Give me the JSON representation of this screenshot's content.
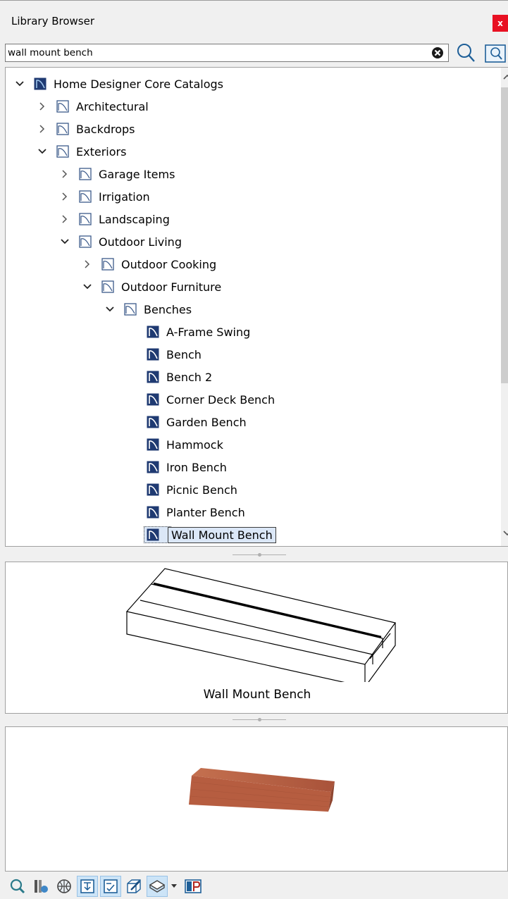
{
  "window": {
    "title": "Library Browser",
    "close_label": "x"
  },
  "search": {
    "value": "wall mount bench"
  },
  "tree": {
    "rows": [
      {
        "label": "Home Designer Core Catalogs",
        "level": 0,
        "state": "expanded",
        "icon": "catalog-root-icon"
      },
      {
        "label": "Architectural",
        "level": 1,
        "state": "collapsed",
        "icon": "folder-icon"
      },
      {
        "label": "Backdrops",
        "level": 1,
        "state": "collapsed",
        "icon": "folder-icon"
      },
      {
        "label": "Exteriors",
        "level": 1,
        "state": "expanded",
        "icon": "folder-icon"
      },
      {
        "label": "Garage Items",
        "level": 2,
        "state": "collapsed",
        "icon": "folder-icon"
      },
      {
        "label": "Irrigation",
        "level": 2,
        "state": "collapsed",
        "icon": "folder-icon"
      },
      {
        "label": "Landscaping",
        "level": 2,
        "state": "collapsed",
        "icon": "folder-icon"
      },
      {
        "label": "Outdoor Living",
        "level": 2,
        "state": "expanded",
        "icon": "folder-icon"
      },
      {
        "label": "Outdoor Cooking",
        "level": 3,
        "state": "collapsed",
        "icon": "folder-icon"
      },
      {
        "label": "Outdoor Furniture",
        "level": 3,
        "state": "expanded",
        "icon": "folder-icon"
      },
      {
        "label": "Benches",
        "level": 4,
        "state": "expanded",
        "icon": "folder-icon"
      },
      {
        "label": "A-Frame Swing",
        "level": 5,
        "state": "leaf",
        "icon": "library-item-icon"
      },
      {
        "label": "Bench",
        "level": 5,
        "state": "leaf",
        "icon": "library-item-icon"
      },
      {
        "label": "Bench 2",
        "level": 5,
        "state": "leaf",
        "icon": "library-item-icon"
      },
      {
        "label": "Corner Deck Bench",
        "level": 5,
        "state": "leaf",
        "icon": "library-item-icon"
      },
      {
        "label": "Garden Bench",
        "level": 5,
        "state": "leaf",
        "icon": "library-item-icon"
      },
      {
        "label": "Hammock",
        "level": 5,
        "state": "leaf",
        "icon": "library-item-icon"
      },
      {
        "label": "Iron Bench",
        "level": 5,
        "state": "leaf",
        "icon": "library-item-icon"
      },
      {
        "label": "Picnic Bench",
        "level": 5,
        "state": "leaf",
        "icon": "library-item-icon"
      },
      {
        "label": "Planter Bench",
        "level": 5,
        "state": "leaf",
        "icon": "library-item-icon"
      },
      {
        "label": "Wall Mount Bench",
        "level": 5,
        "state": "leaf",
        "icon": "library-item-icon",
        "selected": true
      }
    ]
  },
  "preview": {
    "label": "Wall Mount Bench"
  },
  "toolbar": {
    "buttons": [
      {
        "icon": "find-icon",
        "active": false
      },
      {
        "icon": "object-library-icon",
        "active": false
      },
      {
        "icon": "globe-library-icon",
        "active": false
      },
      {
        "icon": "tree-view-icon",
        "active": true
      },
      {
        "icon": "list-view-icon",
        "active": true
      },
      {
        "icon": "3d-view-icon",
        "active": false
      },
      {
        "icon": "preview-render-icon",
        "active": true,
        "has_dropdown": true
      },
      {
        "icon": "ep-icon",
        "active": false
      }
    ]
  },
  "colors": {
    "accent": "#1f3a72",
    "selection": "#dbe7f7",
    "close": "#e81123",
    "wood": "#b5603f"
  }
}
